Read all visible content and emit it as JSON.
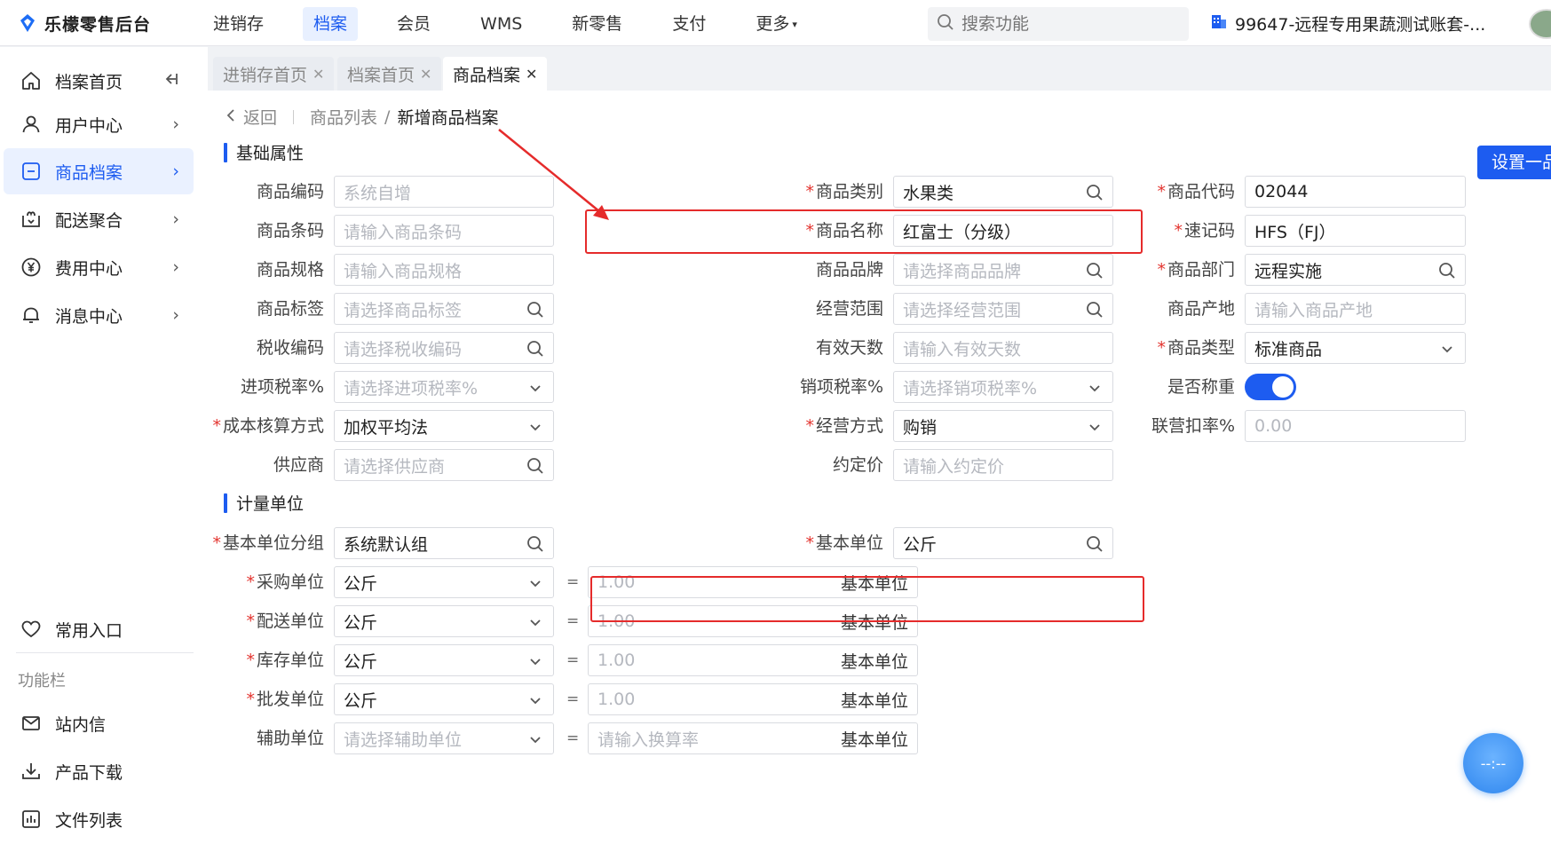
{
  "app": {
    "title": "乐檬零售后台"
  },
  "topnav": [
    {
      "label": "进销存",
      "active": false
    },
    {
      "label": "档案",
      "active": true
    },
    {
      "label": "会员",
      "active": false
    },
    {
      "label": "WMS",
      "active": false
    },
    {
      "label": "新零售",
      "active": false
    },
    {
      "label": "支付",
      "active": false
    },
    {
      "label": "更多",
      "active": false
    }
  ],
  "search": {
    "placeholder": "搜索功能"
  },
  "account": {
    "name": "99647-远程专用果蔬测试账套-..."
  },
  "sidebar": {
    "items": [
      {
        "label": "档案首页",
        "icon": "home-icon"
      },
      {
        "label": "用户中心",
        "icon": "user-icon"
      },
      {
        "label": "商品档案",
        "icon": "product-icon",
        "active": true
      },
      {
        "label": "配送聚合",
        "icon": "delivery-icon"
      },
      {
        "label": "费用中心",
        "icon": "yen-icon"
      },
      {
        "label": "消息中心",
        "icon": "bell-icon"
      }
    ],
    "favorites_label": "常用入口",
    "section_label": "功能栏",
    "tools": [
      {
        "label": "站内信",
        "icon": "mail-icon"
      },
      {
        "label": "产品下载",
        "icon": "download-icon"
      },
      {
        "label": "文件列表",
        "icon": "chart-list-icon"
      }
    ]
  },
  "tabs": [
    {
      "label": "进销存首页",
      "active": false
    },
    {
      "label": "档案首页",
      "active": false
    },
    {
      "label": "商品档案",
      "active": true
    }
  ],
  "breadcrumb": {
    "back": "返回",
    "parent": "商品列表",
    "current": "新增商品档案"
  },
  "set_button": "设置一品多码",
  "sections": {
    "basic": "基础属性",
    "units": "计量单位"
  },
  "basic_fields": {
    "code": {
      "label": "商品编码",
      "placeholder": "系统自增"
    },
    "category": {
      "label": "商品类别",
      "value": "水果类",
      "required": true
    },
    "product_code": {
      "label": "商品代码",
      "value": "02044",
      "required": true
    },
    "barcode": {
      "label": "商品条码",
      "placeholder": "请输入商品条码"
    },
    "name": {
      "label": "商品名称",
      "value": "红富士（分级）",
      "required": true
    },
    "mnemonic": {
      "label": "速记码",
      "value": "HFS（FJ）",
      "required": true
    },
    "spec": {
      "label": "商品规格",
      "placeholder": "请输入商品规格"
    },
    "brand": {
      "label": "商品品牌",
      "placeholder": "请选择商品品牌"
    },
    "dept": {
      "label": "商品部门",
      "value": "远程实施",
      "required": true
    },
    "tag": {
      "label": "商品标签",
      "placeholder": "请选择商品标签"
    },
    "scope": {
      "label": "经营范围",
      "placeholder": "请选择经营范围"
    },
    "origin": {
      "label": "商品产地",
      "placeholder": "请输入商品产地"
    },
    "tax_code": {
      "label": "税收编码",
      "placeholder": "请选择税收编码"
    },
    "valid_days": {
      "label": "有效天数",
      "placeholder": "请输入有效天数"
    },
    "type": {
      "label": "商品类型",
      "value": "标准商品",
      "required": true
    },
    "in_tax": {
      "label": "进项税率%",
      "placeholder": "请选择进项税率%"
    },
    "out_tax": {
      "label": "销项税率%",
      "placeholder": "请选择销项税率%"
    },
    "weighing": {
      "label": "是否称重",
      "on": true
    },
    "cost_method": {
      "label": "成本核算方式",
      "value": "加权平均法",
      "required": true
    },
    "biz_mode": {
      "label": "经营方式",
      "value": "购销",
      "required": true
    },
    "joint_rate": {
      "label": "联营扣率%",
      "placeholder": "0.00"
    },
    "supplier": {
      "label": "供应商",
      "placeholder": "请选择供应商"
    },
    "agreed_price": {
      "label": "约定价",
      "placeholder": "请输入约定价"
    }
  },
  "unit_fields": {
    "base_group": {
      "label": "基本单位分组",
      "value": "系统默认组",
      "required": true
    },
    "base_unit": {
      "label": "基本单位",
      "value": "公斤",
      "required": true
    },
    "equals": "=",
    "suffix": "基本单位",
    "rows": [
      {
        "label": "采购单位",
        "value": "公斤",
        "ratio_placeholder": "1.00",
        "required": true
      },
      {
        "label": "配送单位",
        "value": "公斤",
        "ratio_placeholder": "1.00",
        "required": true
      },
      {
        "label": "库存单位",
        "value": "公斤",
        "ratio_placeholder": "1.00",
        "required": true
      },
      {
        "label": "批发单位",
        "value": "公斤",
        "ratio_placeholder": "1.00",
        "required": true
      },
      {
        "label": "辅助单位",
        "placeholder": "请选择辅助单位",
        "ratio_placeholder": "请输入换算率",
        "required": false
      }
    ]
  },
  "float_button": "--:--",
  "colors": {
    "primary": "#1d5cf0",
    "annotation": "#e52b2b",
    "required": "#e3342f"
  }
}
